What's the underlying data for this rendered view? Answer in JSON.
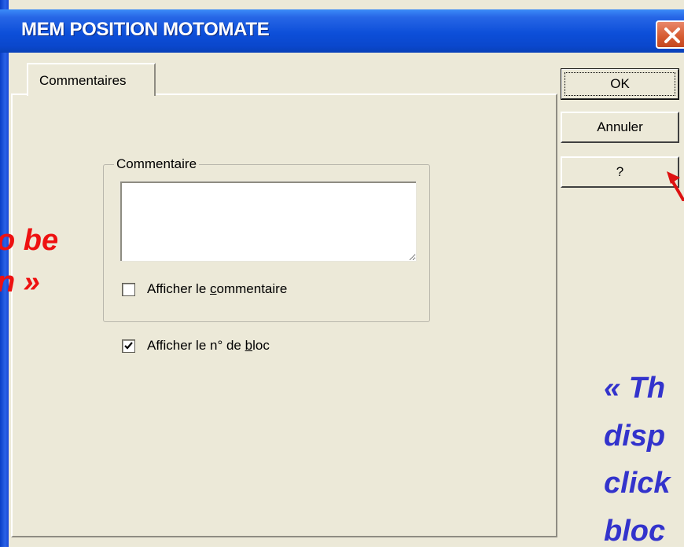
{
  "window": {
    "title": "MEM POSITION MOTOMATE",
    "close_icon": "close-icon"
  },
  "tabs": [
    {
      "label": "Commentaires",
      "selected": true
    }
  ],
  "comment_group": {
    "label": "Commentaire",
    "textarea_value": "",
    "show_comment": {
      "label_before": "Afficher le ",
      "label_underlined": "c",
      "label_after": "ommentaire",
      "checked": false
    }
  },
  "show_block": {
    "label_before": "Afficher le n° de ",
    "label_underlined": "b",
    "label_after": "loc",
    "checked": true
  },
  "buttons": {
    "ok": "OK",
    "cancel": "Annuler",
    "help": "?"
  },
  "annotations": {
    "left_line1": "o be",
    "left_line2": "n »",
    "right_line1": "« Th",
    "right_line2": "disp",
    "right_line3": "click",
    "right_line4": "bloc",
    "left_color": "#ee1111",
    "right_color": "#3333cc",
    "arrow_color": "#dd1111"
  }
}
